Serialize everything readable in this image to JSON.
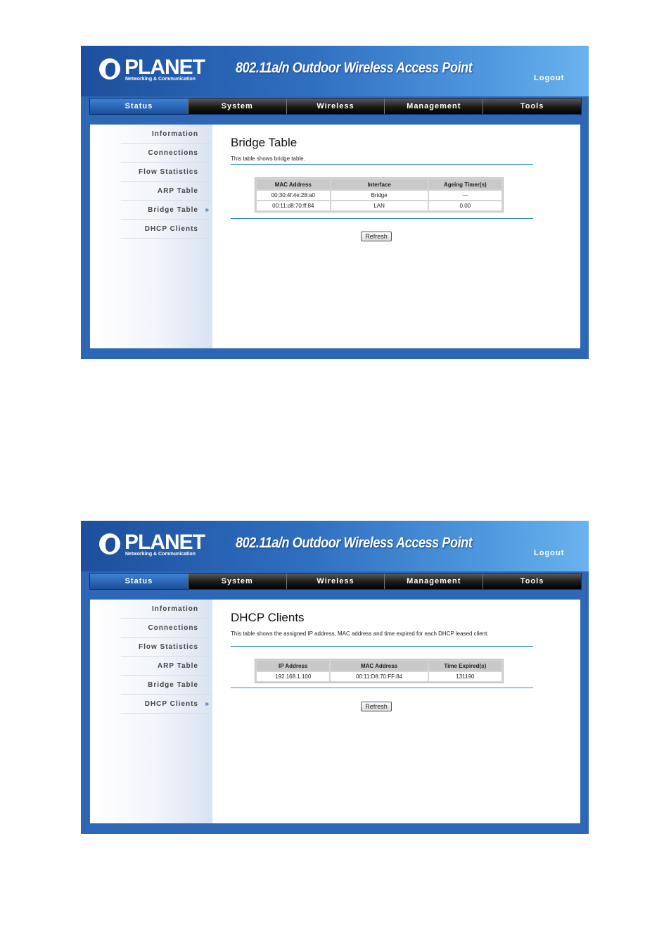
{
  "brand": {
    "logo_text": "PLANET",
    "logo_sub": "Networking & Communication",
    "banner": "802.11a/n Outdoor Wireless Access Point",
    "logout": "Logout"
  },
  "nav": [
    "Status",
    "System",
    "Wireless",
    "Management",
    "Tools"
  ],
  "sidebar": [
    "Information",
    "Connections",
    "Flow Statistics",
    "ARP Table",
    "Bridge Table",
    "DHCP Clients"
  ],
  "sidebar_arrow": "»",
  "bridge": {
    "title": "Bridge Table",
    "desc": "This table shows bridge table.",
    "headers": [
      "MAC Address",
      "Interface",
      "Ageing Timer(s)"
    ],
    "rows": [
      [
        "00:30:4f:4e:28:a0",
        "Bridge",
        "---"
      ],
      [
        "00:11:d8:70:ff:84",
        "LAN",
        "0.00"
      ]
    ],
    "refresh": "Refresh"
  },
  "dhcp": {
    "title": "DHCP Clients",
    "desc": "This table shows the assigned IP address, MAC address and time expired for each DHCP leased client.",
    "headers": [
      "IP Address",
      "MAC Address",
      "Time Expired(s)"
    ],
    "rows": [
      [
        "192.168.1.100",
        "00:11:D8:70:FF:84",
        "131190"
      ]
    ],
    "refresh": "Refresh"
  }
}
